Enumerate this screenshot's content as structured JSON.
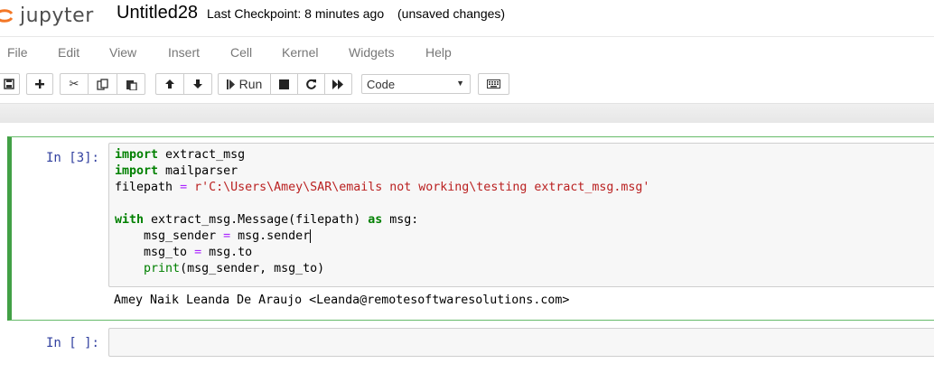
{
  "header": {
    "logo_text": "jupyter",
    "notebook_name": "Untitled28",
    "checkpoint": "Last Checkpoint: 8 minutes ago",
    "autosave_status": "(unsaved changes)"
  },
  "menubar": {
    "items": [
      "File",
      "Edit",
      "View",
      "Insert",
      "Cell",
      "Kernel",
      "Widgets",
      "Help"
    ]
  },
  "toolbar": {
    "run_label": "Run",
    "cell_type": "Code",
    "icons": [
      "save-icon",
      "plus-icon",
      "cut-icon",
      "copy-icon",
      "paste-icon",
      "arrow-up-icon",
      "arrow-down-icon",
      "step-forward-icon",
      "stop-icon",
      "restart-icon",
      "fast-forward-icon",
      "keyboard-icon"
    ]
  },
  "cells": [
    {
      "prompt": "In [3]:",
      "code_lines": [
        [
          "import",
          " extract_msg"
        ],
        [
          "import",
          " mailparser"
        ],
        [
          "filepath ",
          "=",
          " ",
          "r'C:\\Users\\Amey\\SAR\\emails not working\\testing extract_msg.msg'"
        ],
        [
          ""
        ],
        [
          "with",
          " extract_msg.Message(filepath) ",
          "as",
          " msg:"
        ],
        [
          "    msg_sender ",
          "=",
          " msg.sender"
        ],
        [
          "    msg_to ",
          "=",
          " msg.to"
        ],
        [
          "    ",
          "print",
          "(msg_sender, msg_to)"
        ]
      ],
      "output": "Amey Naik Leanda De Araujo <Leanda@remotesoftwaresolutions.com>"
    },
    {
      "prompt": "In [ ]:",
      "code_lines": [],
      "output": ""
    }
  ],
  "colors": {
    "keyword": "#008000",
    "operator": "#aa22ff",
    "string": "#ba2121",
    "selected_border": "#42a045",
    "prompt": "#303f9f"
  }
}
